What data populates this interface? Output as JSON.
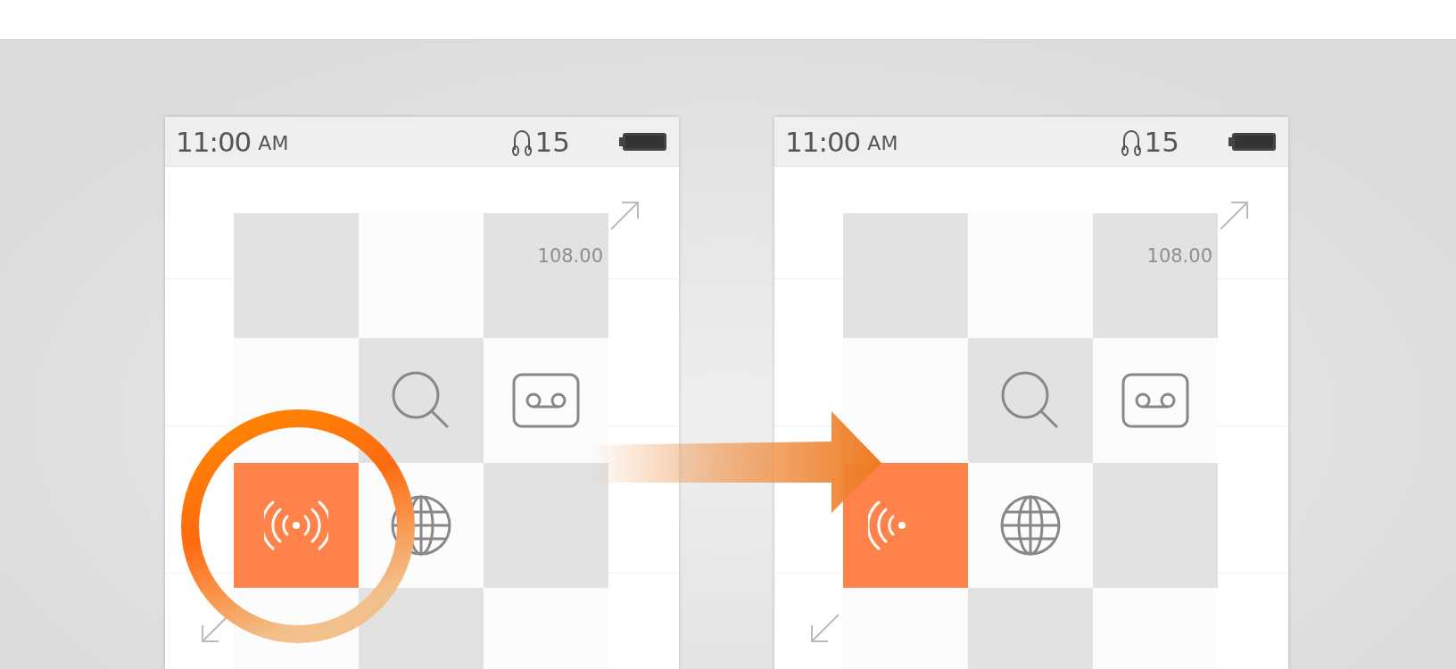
{
  "phones": [
    {
      "highlighted": true,
      "status_bar": {
        "time": "11:00",
        "ampm": "AM",
        "volume": "15"
      },
      "price": "108.00",
      "tiles": [
        {
          "kind": "blank",
          "selected": false
        },
        {
          "kind": "blank",
          "selected": false
        },
        {
          "kind": "blank",
          "selected": false
        },
        {
          "kind": "blank",
          "selected": false
        },
        {
          "kind": "search",
          "selected": false
        },
        {
          "kind": "voicemail",
          "selected": false
        },
        {
          "kind": "broadcast",
          "selected": true
        },
        {
          "kind": "globe",
          "selected": false
        },
        {
          "kind": "blank",
          "selected": false
        },
        {
          "kind": "blank",
          "selected": false
        },
        {
          "kind": "blank",
          "selected": false
        },
        {
          "kind": "blank",
          "selected": false
        }
      ]
    },
    {
      "highlighted": false,
      "status_bar": {
        "time": "11:00",
        "ampm": "AM",
        "volume": "15"
      },
      "price": "108.00",
      "tiles": [
        {
          "kind": "blank",
          "selected": false
        },
        {
          "kind": "blank",
          "selected": false
        },
        {
          "kind": "blank",
          "selected": false
        },
        {
          "kind": "blank",
          "selected": false
        },
        {
          "kind": "search",
          "selected": false
        },
        {
          "kind": "voicemail",
          "selected": false
        },
        {
          "kind": "signal-left",
          "selected": true
        },
        {
          "kind": "globe",
          "selected": false
        },
        {
          "kind": "blank",
          "selected": false
        },
        {
          "kind": "blank",
          "selected": false
        },
        {
          "kind": "blank",
          "selected": false
        },
        {
          "kind": "blank",
          "selected": false
        }
      ]
    }
  ],
  "transition_arrow": true
}
